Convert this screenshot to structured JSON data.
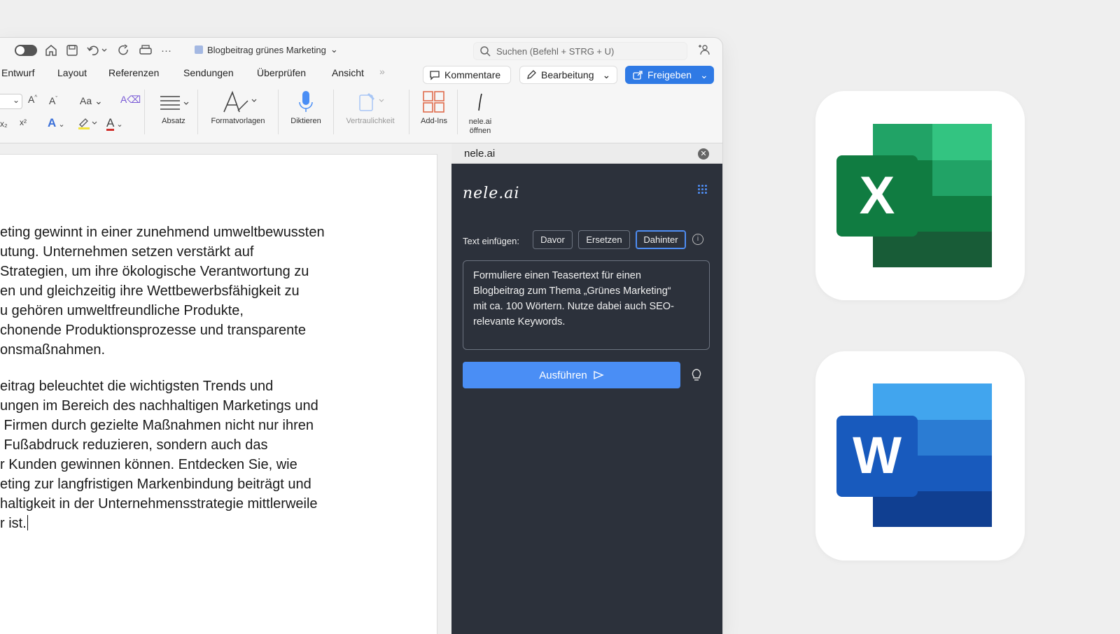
{
  "word": {
    "document_title": "Blogbeitrag grünes Marketing",
    "search_placeholder": "Suchen (Befehl + STRG + U)",
    "tabs": [
      "Entwurf",
      "Layout",
      "Referenzen",
      "Sendungen",
      "Überprüfen",
      "Ansicht"
    ],
    "buttons": {
      "comments": "Kommentare",
      "editing": "Bearbeitung",
      "share": "Freigeben"
    },
    "ribbon": {
      "paragraph": "Absatz",
      "styles": "Formatvorlagen",
      "dictate": "Diktieren",
      "sensitivity": "Vertraulichkeit",
      "addins": "Add-Ins",
      "nele_line1": "nele.ai",
      "nele_line2": "öffnen"
    },
    "document_paragraphs": [
      [
        "eting gewinnt in einer zunehmend umweltbewussten",
        "utung. Unternehmen setzen verstärkt auf",
        "Strategien, um ihre ökologische Verantwortung zu",
        "en und gleichzeitig ihre Wettbewerbsfähigkeit zu",
        "u gehören umweltfreundliche Produkte,",
        "chonende Produktionsprozesse und transparente",
        "onsmaßnahmen."
      ],
      [
        "eitrag beleuchtet die wichtigsten Trends und",
        "ungen im Bereich des nachhaltigen Marketings und",
        " Firmen durch gezielte Maßnahmen nicht nur ihren",
        " Fußabdruck reduzieren, sondern auch das",
        "r Kunden gewinnen können. Entdecken Sie, wie",
        "eting zur langfristigen Markenbindung beiträgt und",
        "haltigkeit in der Unternehmensstrategie mittlerweile",
        "r ist."
      ]
    ]
  },
  "nele": {
    "panel_title": "nele.ai",
    "logo": "nele.ai",
    "insert_label": "Text einfügen:",
    "insert_options": [
      "Davor",
      "Ersetzen",
      "Dahinter"
    ],
    "active_option": "Dahinter",
    "prompt": "Formuliere einen Teasertext für einen\nBlogbeitrag zum Thema „Grünes Marketing“\nmit ca. 100 Wörtern. Nutze dabei auch SEO-\nrelevante Keywords.",
    "run_label": "Ausführen",
    "accent": "#4a8ef5"
  },
  "apps": {
    "excel_letter": "X",
    "word_letter": "W",
    "excel_color": "#107c41",
    "word_color": "#185abd"
  }
}
